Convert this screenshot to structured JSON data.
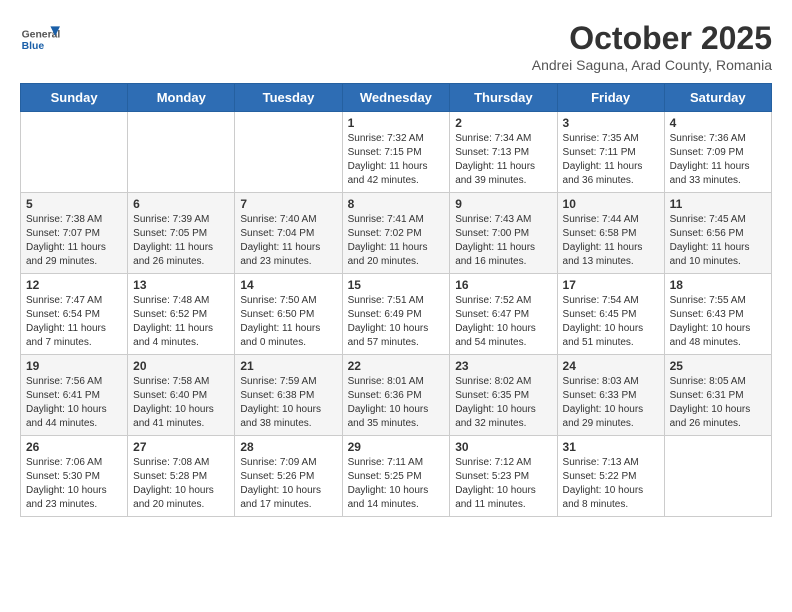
{
  "header": {
    "logo": {
      "general": "General",
      "blue": "Blue"
    },
    "month": "October 2025",
    "location": "Andrei Saguna, Arad County, Romania"
  },
  "weekdays": [
    "Sunday",
    "Monday",
    "Tuesday",
    "Wednesday",
    "Thursday",
    "Friday",
    "Saturday"
  ],
  "weeks": [
    [
      {
        "day": "",
        "info": ""
      },
      {
        "day": "",
        "info": ""
      },
      {
        "day": "",
        "info": ""
      },
      {
        "day": "1",
        "info": "Sunrise: 7:32 AM\nSunset: 7:15 PM\nDaylight: 11 hours and 42 minutes."
      },
      {
        "day": "2",
        "info": "Sunrise: 7:34 AM\nSunset: 7:13 PM\nDaylight: 11 hours and 39 minutes."
      },
      {
        "day": "3",
        "info": "Sunrise: 7:35 AM\nSunset: 7:11 PM\nDaylight: 11 hours and 36 minutes."
      },
      {
        "day": "4",
        "info": "Sunrise: 7:36 AM\nSunset: 7:09 PM\nDaylight: 11 hours and 33 minutes."
      }
    ],
    [
      {
        "day": "5",
        "info": "Sunrise: 7:38 AM\nSunset: 7:07 PM\nDaylight: 11 hours and 29 minutes."
      },
      {
        "day": "6",
        "info": "Sunrise: 7:39 AM\nSunset: 7:05 PM\nDaylight: 11 hours and 26 minutes."
      },
      {
        "day": "7",
        "info": "Sunrise: 7:40 AM\nSunset: 7:04 PM\nDaylight: 11 hours and 23 minutes."
      },
      {
        "day": "8",
        "info": "Sunrise: 7:41 AM\nSunset: 7:02 PM\nDaylight: 11 hours and 20 minutes."
      },
      {
        "day": "9",
        "info": "Sunrise: 7:43 AM\nSunset: 7:00 PM\nDaylight: 11 hours and 16 minutes."
      },
      {
        "day": "10",
        "info": "Sunrise: 7:44 AM\nSunset: 6:58 PM\nDaylight: 11 hours and 13 minutes."
      },
      {
        "day": "11",
        "info": "Sunrise: 7:45 AM\nSunset: 6:56 PM\nDaylight: 11 hours and 10 minutes."
      }
    ],
    [
      {
        "day": "12",
        "info": "Sunrise: 7:47 AM\nSunset: 6:54 PM\nDaylight: 11 hours and 7 minutes."
      },
      {
        "day": "13",
        "info": "Sunrise: 7:48 AM\nSunset: 6:52 PM\nDaylight: 11 hours and 4 minutes."
      },
      {
        "day": "14",
        "info": "Sunrise: 7:50 AM\nSunset: 6:50 PM\nDaylight: 11 hours and 0 minutes."
      },
      {
        "day": "15",
        "info": "Sunrise: 7:51 AM\nSunset: 6:49 PM\nDaylight: 10 hours and 57 minutes."
      },
      {
        "day": "16",
        "info": "Sunrise: 7:52 AM\nSunset: 6:47 PM\nDaylight: 10 hours and 54 minutes."
      },
      {
        "day": "17",
        "info": "Sunrise: 7:54 AM\nSunset: 6:45 PM\nDaylight: 10 hours and 51 minutes."
      },
      {
        "day": "18",
        "info": "Sunrise: 7:55 AM\nSunset: 6:43 PM\nDaylight: 10 hours and 48 minutes."
      }
    ],
    [
      {
        "day": "19",
        "info": "Sunrise: 7:56 AM\nSunset: 6:41 PM\nDaylight: 10 hours and 44 minutes."
      },
      {
        "day": "20",
        "info": "Sunrise: 7:58 AM\nSunset: 6:40 PM\nDaylight: 10 hours and 41 minutes."
      },
      {
        "day": "21",
        "info": "Sunrise: 7:59 AM\nSunset: 6:38 PM\nDaylight: 10 hours and 38 minutes."
      },
      {
        "day": "22",
        "info": "Sunrise: 8:01 AM\nSunset: 6:36 PM\nDaylight: 10 hours and 35 minutes."
      },
      {
        "day": "23",
        "info": "Sunrise: 8:02 AM\nSunset: 6:35 PM\nDaylight: 10 hours and 32 minutes."
      },
      {
        "day": "24",
        "info": "Sunrise: 8:03 AM\nSunset: 6:33 PM\nDaylight: 10 hours and 29 minutes."
      },
      {
        "day": "25",
        "info": "Sunrise: 8:05 AM\nSunset: 6:31 PM\nDaylight: 10 hours and 26 minutes."
      }
    ],
    [
      {
        "day": "26",
        "info": "Sunrise: 7:06 AM\nSunset: 5:30 PM\nDaylight: 10 hours and 23 minutes."
      },
      {
        "day": "27",
        "info": "Sunrise: 7:08 AM\nSunset: 5:28 PM\nDaylight: 10 hours and 20 minutes."
      },
      {
        "day": "28",
        "info": "Sunrise: 7:09 AM\nSunset: 5:26 PM\nDaylight: 10 hours and 17 minutes."
      },
      {
        "day": "29",
        "info": "Sunrise: 7:11 AM\nSunset: 5:25 PM\nDaylight: 10 hours and 14 minutes."
      },
      {
        "day": "30",
        "info": "Sunrise: 7:12 AM\nSunset: 5:23 PM\nDaylight: 10 hours and 11 minutes."
      },
      {
        "day": "31",
        "info": "Sunrise: 7:13 AM\nSunset: 5:22 PM\nDaylight: 10 hours and 8 minutes."
      },
      {
        "day": "",
        "info": ""
      }
    ]
  ]
}
